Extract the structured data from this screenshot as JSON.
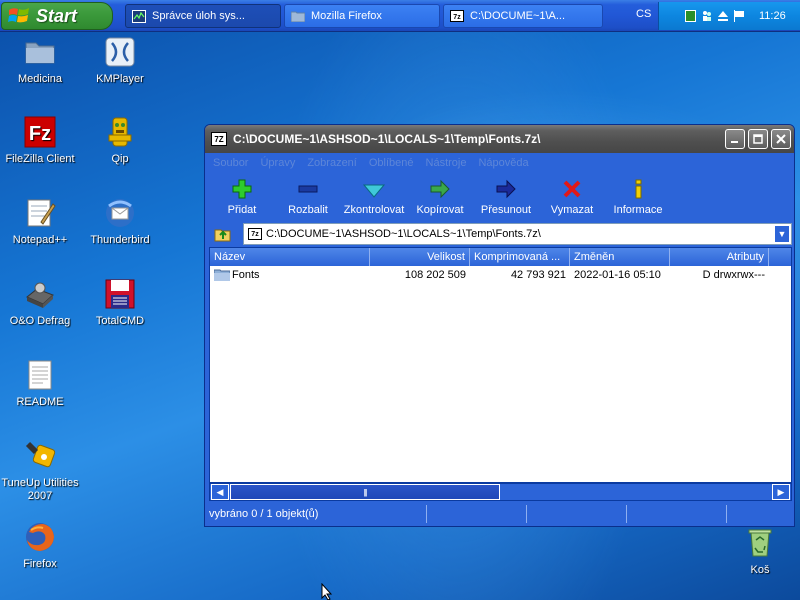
{
  "taskbar": {
    "start_label": "Start",
    "tasks": [
      {
        "label": "Správce úloh sys..."
      },
      {
        "label": "Mozilla Firefox"
      },
      {
        "label": "C:\\DOCUME~1\\A..."
      }
    ],
    "language": "CS",
    "clock": "11:26"
  },
  "desktop": {
    "icons": [
      {
        "label": "Medicina"
      },
      {
        "label": "KMPlayer"
      },
      {
        "label": "FileZilla Client"
      },
      {
        "label": "Qip"
      },
      {
        "label": "Notepad++"
      },
      {
        "label": "Thunderbird"
      },
      {
        "label": "O&O Defrag"
      },
      {
        "label": "TotalCMD"
      },
      {
        "label": "README"
      },
      {
        "label": "TuneUp Utilities 2007"
      },
      {
        "label": "Firefox"
      },
      {
        "label": "Koš"
      }
    ]
  },
  "window": {
    "title": "C:\\DOCUME~1\\ASHSOD~1\\LOCALS~1\\Temp\\Fonts.7z\\",
    "app_icon_text": "7Z",
    "menu": [
      "Soubor",
      "Úpravy",
      "Zobrazení",
      "Oblíbené",
      "Nástroje",
      "Nápověda"
    ],
    "toolbar": [
      "Přidat",
      "Rozbalit",
      "Zkontrolovat",
      "Kopírovat",
      "Přesunout",
      "Vymazat",
      "Informace"
    ],
    "address": "C:\\DOCUME~1\\ASHSOD~1\\LOCALS~1\\Temp\\Fonts.7z\\",
    "columns": [
      "Název",
      "Velikost",
      "Komprimovaná ...",
      "Změněn",
      "Atributy"
    ],
    "rows": [
      {
        "name": "Fonts",
        "size": "108 202 509",
        "packed": "42 793 921",
        "modified": "2022-01-16 05:10",
        "attributes": "D drwxrwx---"
      }
    ],
    "status": "vybráno 0 / 1 objekt(ů)",
    "scroll_grip": "|||"
  },
  "colors": {
    "window_blue": "#2c64d8",
    "titlebar_gray": "#5e5e5e",
    "taskbar_blue": "#245edb",
    "start_green": "#3c9a3c"
  }
}
